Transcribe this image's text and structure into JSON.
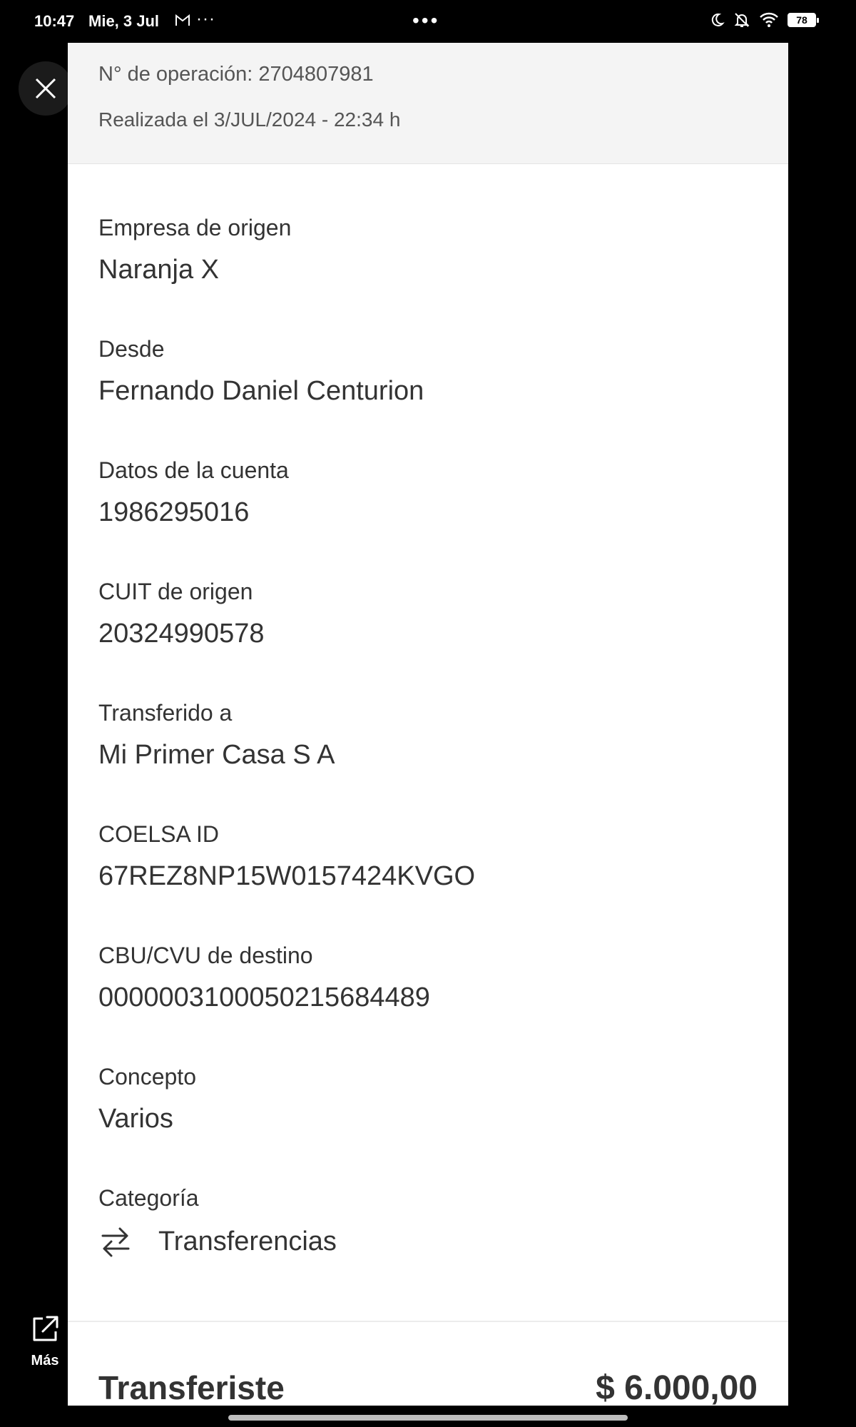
{
  "status_bar": {
    "time": "10:47",
    "date": "Mie, 3 Jul",
    "gmail_icon": "M",
    "more_left": "···",
    "center_dots": "•••",
    "battery": "78"
  },
  "header": {
    "operation_number": "N° de operación: 2704807981",
    "performed_at": "Realizada el 3/JUL/2024 - 22:34 h"
  },
  "details": [
    {
      "label": "Empresa de origen",
      "value": "Naranja X"
    },
    {
      "label": "Desde",
      "value": "Fernando Daniel Centurion"
    },
    {
      "label": "Datos de la cuenta",
      "value": "1986295016"
    },
    {
      "label": "CUIT de origen",
      "value": "20324990578"
    },
    {
      "label": "Transferido a",
      "value": "Mi Primer Casa S A"
    },
    {
      "label": "COELSA ID",
      "value": "67REZ8NP15W0157424KVGO"
    },
    {
      "label": "CBU/CVU de destino",
      "value": "0000003100050215684489"
    },
    {
      "label": "Concepto",
      "value": "Varios"
    }
  ],
  "category": {
    "label": "Categoría",
    "value": "Transferencias",
    "icon": "transfer-arrows-icon"
  },
  "total": {
    "label": "Transferiste",
    "amount": "$ 6.000,00"
  },
  "side": {
    "more_label": "Más"
  },
  "colors": {
    "background": "#000000",
    "card": "#ffffff",
    "header": "#f4f4f4",
    "text": "#333333"
  }
}
